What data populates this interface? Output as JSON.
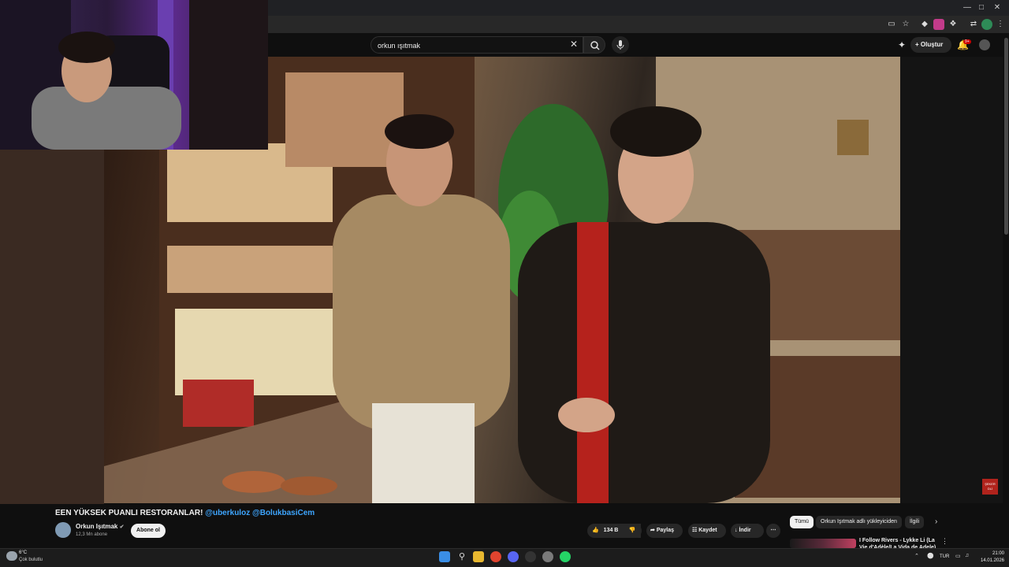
{
  "search": {
    "value": "orkun ışıtmak"
  },
  "header": {
    "create_label": "Oluştur",
    "notifications_badge": "9+"
  },
  "video": {
    "title_prefix": "EEN YÜKSEK PUANLI RESTORANLAR!",
    "title_tags": "@uberkuloz @BolukbasiCem",
    "overlay_watermark": "ŞEKER\nDLİ"
  },
  "channel": {
    "name": "Orkun Işıtmak",
    "verified_icon": "verified-check-icon",
    "subscribers": "12,3 Mn abone",
    "subscribe_label": "Abone ol"
  },
  "actions": {
    "likes": "134 B",
    "share_label": "Paylaş",
    "save_label": "Kaydet",
    "download_label": "İndir"
  },
  "sidebar": {
    "chips": [
      {
        "label": "Tümü",
        "active": true
      },
      {
        "label": "Orkun Işıtmak adlı yükleyiciden",
        "active": false
      },
      {
        "label": "İlgili",
        "active": false
      }
    ],
    "recommendation": {
      "title": "I Follow Rivers - Lykke Li (La Vie d'Adèle/La Vida de Adele)"
    }
  },
  "taskbar": {
    "weather_temp": "6°C",
    "weather_desc": "Çok bulutlu",
    "language": "TUR",
    "time": "21:00",
    "date": "14.01.2026"
  },
  "colors": {
    "background": "#0f0f0f",
    "link": "#3ea6ff",
    "badge": "#cc0000",
    "chip_active": "#f1f1f1"
  }
}
